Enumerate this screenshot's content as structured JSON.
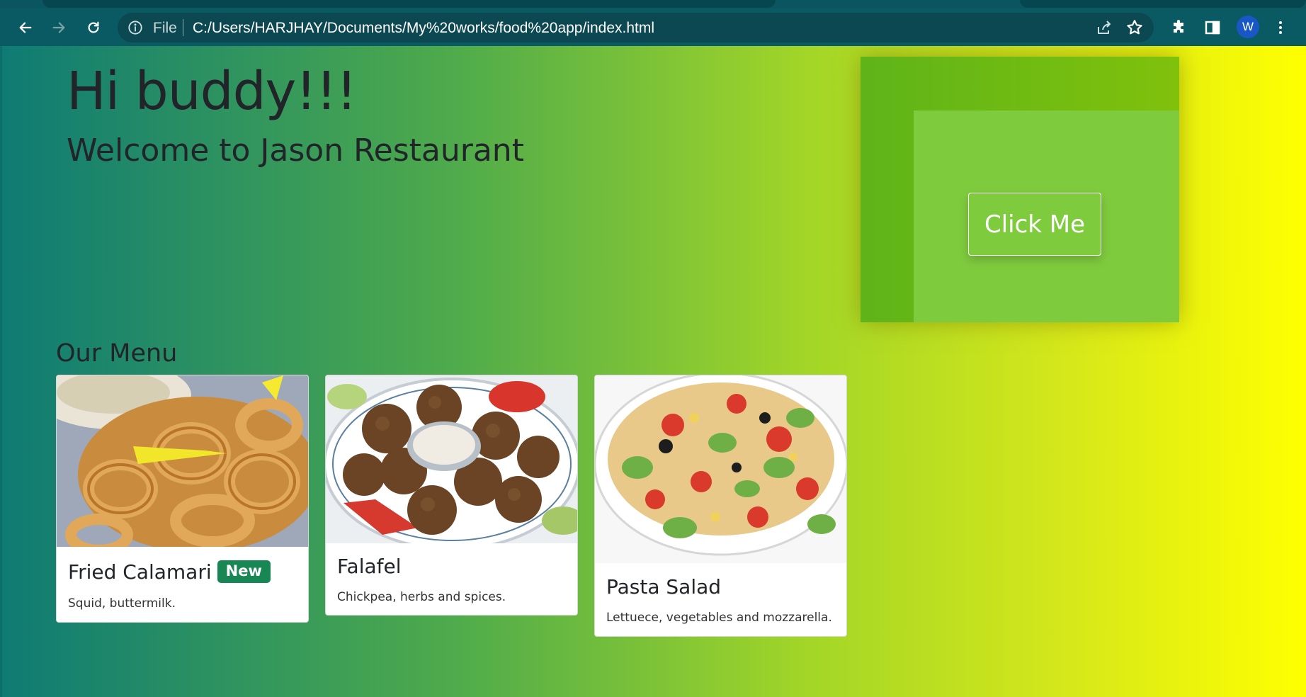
{
  "browser": {
    "file_label": "File",
    "url": "C:/Users/HARJHAY/Documents/My%20works/food%20app/index.html",
    "profile_initial": "W",
    "accent_color": "#0a5a64"
  },
  "hero": {
    "title": "Hi buddy!!!",
    "subtitle": "Welcome to Jason Restaurant"
  },
  "promo": {
    "button_label": "Click Me"
  },
  "menu": {
    "heading": "Our Menu",
    "items": [
      {
        "title": "Fried Calamari",
        "badge": "New",
        "description": "Squid, buttermilk."
      },
      {
        "title": "Falafel",
        "description": "Chickpea, herbs and spices."
      },
      {
        "title": "Pasta Salad",
        "description": "Lettuece, vegetables and mozzarella."
      }
    ]
  }
}
